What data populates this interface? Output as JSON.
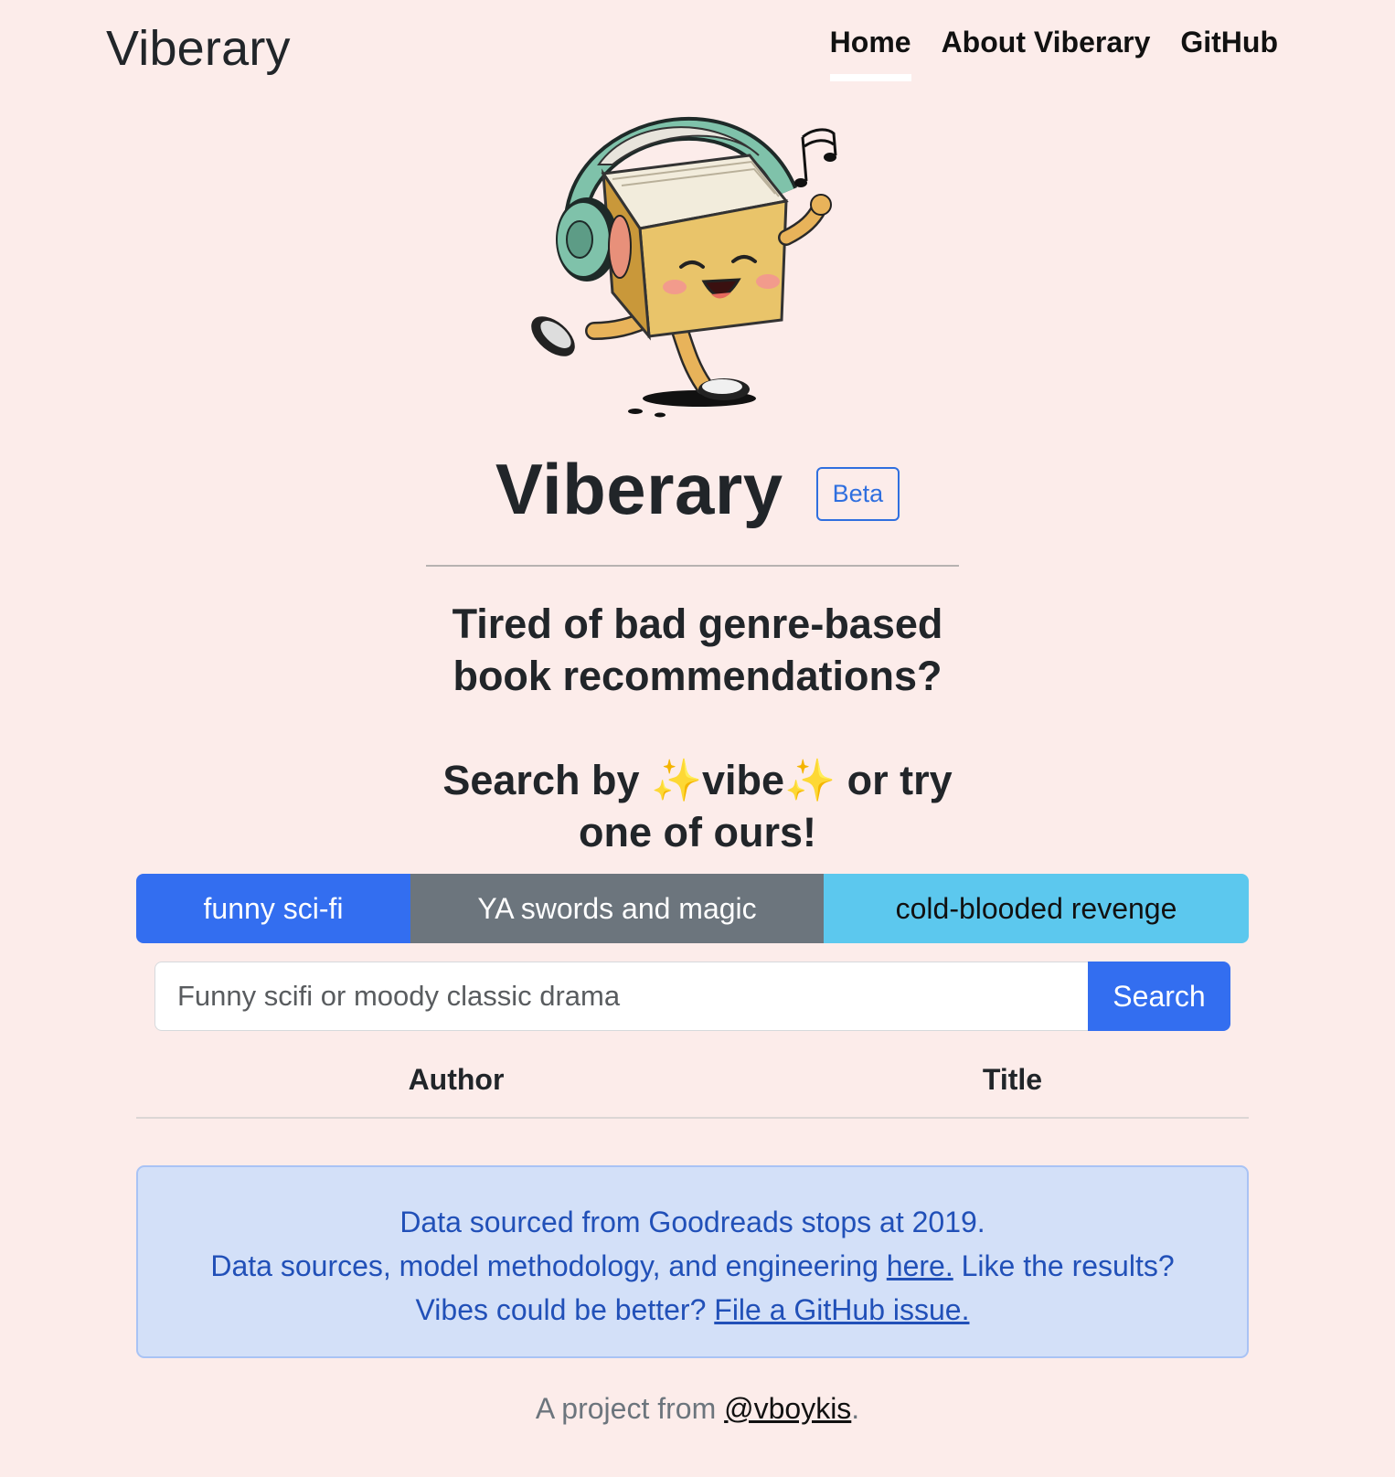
{
  "nav": {
    "brand": "Viberary",
    "links": [
      {
        "label": "Home",
        "active": true
      },
      {
        "label": "About Viberary",
        "active": false
      },
      {
        "label": "GitHub",
        "active": false
      }
    ]
  },
  "hero": {
    "mascot_icon": "dancing-book-with-headphones-mascot",
    "title": "Viberary",
    "badge": "Beta",
    "tagline_line1": "Tired of bad genre-based",
    "tagline_line2": "book recommendations?",
    "search_line1_a": "Search by ",
    "sparkle": "✨",
    "search_line1_b": "vibe",
    "search_line1_c": " or try",
    "search_line2": "one of ours!"
  },
  "presets": [
    {
      "label": "funny sci-fi",
      "color": "#336ef0"
    },
    {
      "label": "YA swords and magic",
      "color": "#6c757d"
    },
    {
      "label": "cold-blooded revenge",
      "color": "#5cc8ee"
    }
  ],
  "search": {
    "placeholder": "Funny scifi or moody classic drama",
    "value": "",
    "button_label": "Search"
  },
  "results": {
    "columns": [
      "Author",
      "Title"
    ],
    "rows": []
  },
  "info": {
    "line1": "Data sourced from Goodreads stops at 2019.",
    "line2_a": "Data sources, model methodology, and engineering ",
    "line2_link": "here.",
    "line2_b": " Like the results?",
    "line3_a": "Vibes could be better? ",
    "line3_link": "File a GitHub issue."
  },
  "footer": {
    "text": "A project from ",
    "link": "@vboykis",
    "end": "."
  },
  "colors": {
    "background": "#fcecea",
    "primary": "#336ef0",
    "secondary": "#6c757d",
    "info": "#5cc8ee",
    "alert_bg": "#d3e0f8",
    "alert_text": "#2150b8"
  }
}
